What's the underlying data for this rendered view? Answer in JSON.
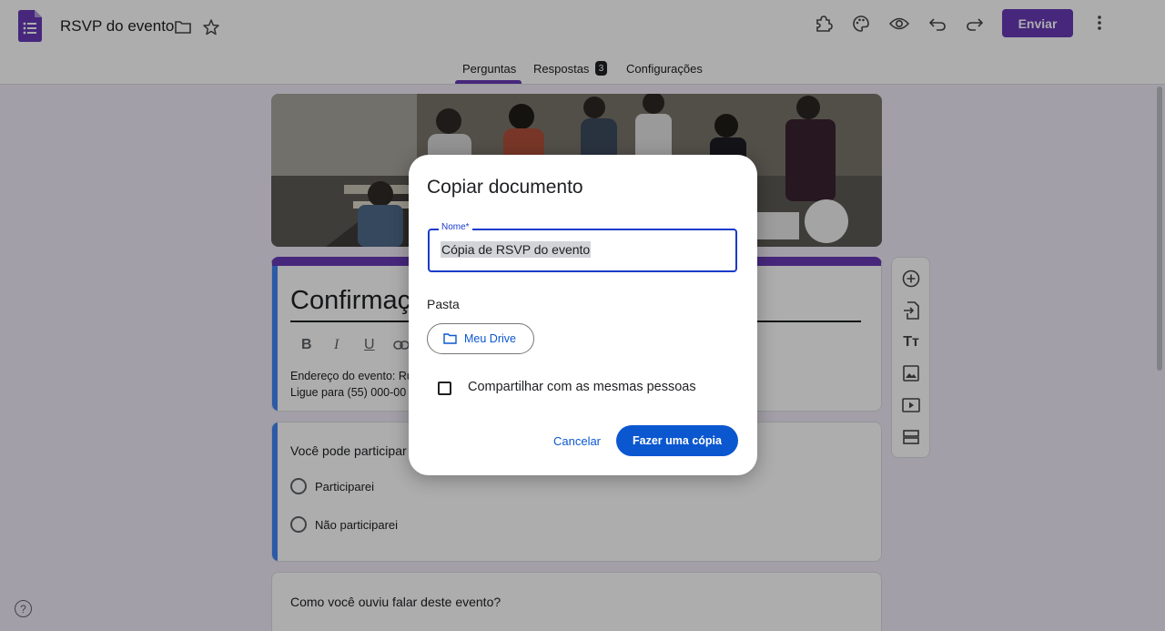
{
  "header": {
    "doc_title": "RSVP do evento",
    "send_label": "Enviar"
  },
  "tabs": {
    "questions": "Perguntas",
    "responses": "Respostas",
    "responses_count": "3",
    "settings": "Configurações"
  },
  "form": {
    "title": "Confirmação",
    "description_line1": "Endereço do evento: Ru",
    "description_line2": "Ligue para (55) 000-00",
    "question1": "Você pode participar",
    "options": [
      "Participarei",
      "Não participarei"
    ],
    "question2": "Como você ouviu falar deste evento?"
  },
  "dialog": {
    "title": "Copiar documento",
    "name_label": "Nome*",
    "name_value": "Cópia de RSVP do evento",
    "folder_label": "Pasta",
    "folder_button": "Meu Drive",
    "share_label": "Compartilhar com as mesmas pessoas",
    "share_checked": false,
    "cancel_label": "Cancelar",
    "confirm_label": "Fazer uma cópia"
  },
  "help_icon": "?",
  "colors": {
    "accent": "#673ab7",
    "primary_button": "#0b57d0",
    "focus_border": "#1a3bcb"
  }
}
